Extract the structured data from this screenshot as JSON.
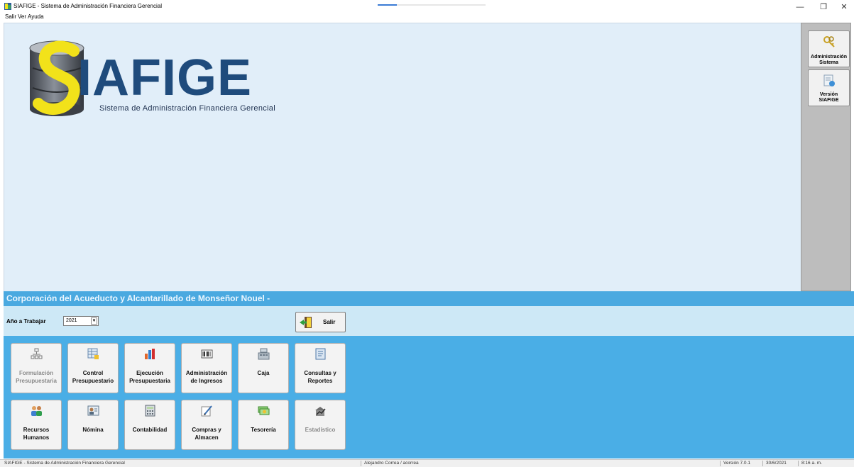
{
  "window": {
    "title": "SIAFIGE - Sistema de Administración Financiera Gerencial",
    "controls": {
      "minimize": "—",
      "restore": "❐",
      "close": "✕"
    },
    "progress_fraction": 0.18
  },
  "menu": {
    "items": [
      "Salir",
      "Ver",
      "Ayuda"
    ]
  },
  "logo": {
    "wordmark": "SIAFIGE",
    "lettering": "IAFIGE",
    "subtitle": "Sistema de Administración Financiera Gerencial"
  },
  "side_panel": {
    "buttons": [
      {
        "line1": "Administración",
        "line2": "Sistema",
        "icon": "keys-icon"
      },
      {
        "line1": "Versión",
        "line2": "SIAFIGE",
        "icon": "info-icon"
      }
    ]
  },
  "organization": {
    "name": "Corporación del Acueducto y Alcantarillado de Monseñor Nouel -"
  },
  "year_bar": {
    "label": "Año a Trabajar",
    "selected_year": "2021",
    "arrow": "▼",
    "exit_label": "Salir"
  },
  "modules": [
    {
      "label": "Formulación\nPresupuestaria",
      "icon": "org-chart-icon",
      "enabled": false
    },
    {
      "label": "Control\nPresupuestario",
      "icon": "spreadsheet-icon",
      "enabled": true
    },
    {
      "label": "Ejecución\nPresupuestaria",
      "icon": "bar-chart-icon",
      "enabled": true
    },
    {
      "label": "Administración\nde Ingresos",
      "icon": "barcode-icon",
      "enabled": true
    },
    {
      "label": "Caja",
      "icon": "cash-register-icon",
      "enabled": true
    },
    {
      "label": "Consultas y\nReportes",
      "icon": "report-icon",
      "enabled": true
    },
    {
      "label": "Recursos\nHumanos",
      "icon": "people-icon",
      "enabled": true
    },
    {
      "label": "Nómina",
      "icon": "payroll-icon",
      "enabled": true
    },
    {
      "label": "Contabilidad",
      "icon": "calculator-icon",
      "enabled": true
    },
    {
      "label": "Compras y\nAlmacen",
      "icon": "pen-paper-icon",
      "enabled": true
    },
    {
      "label": "Tesorería",
      "icon": "money-icon",
      "enabled": true
    },
    {
      "label": "Estadístico",
      "icon": "stats-house-icon",
      "enabled": false
    }
  ],
  "status_bar": {
    "app": "SIAFIGE - Sistema de Administración Financiera Gerencial",
    "user": "Alejandro Correa / acorrea",
    "version": "Versión 7.0.1",
    "date": "30/6/2021",
    "time": "8:16 a. m."
  },
  "colors": {
    "main_bg": "#e1eef9",
    "banner": "#4aa9e0",
    "year_bar": "#cde8f6",
    "modules_bg": "#4aaee6",
    "logo_blue": "#1f4b7c",
    "logo_yellow": "#f2e21a"
  }
}
